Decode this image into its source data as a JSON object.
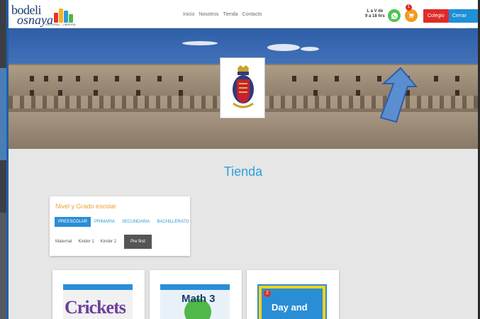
{
  "brand": {
    "name_line1": "bodeli",
    "name_line2": "osnaya",
    "tagline": "EDITORIAL · LIBRERÍA"
  },
  "nav": {
    "links": [
      "Inicio",
      "Nosotros",
      "Tienda",
      "Contacto"
    ]
  },
  "header": {
    "hours": "L a V de\n9 a 18 hrs",
    "cart_count": "1",
    "colegio_label": "Colegio",
    "logout_label": "Cerrar Sesion"
  },
  "page": {
    "title": "Tienda"
  },
  "level_filter": {
    "heading": "Nivel y Grado escolar",
    "levels": [
      "PREESCOLAR",
      "PRIMARIA",
      "SECUNDARIA",
      "BACHILLERATO"
    ],
    "active_level": "PREESCOLAR",
    "grades": [
      "Maternal",
      "Kinder 1",
      "Kinder 2",
      "Pre first"
    ],
    "active_grade": "Pre first"
  },
  "products": [
    {
      "cover_text": "Crickets"
    },
    {
      "cover_text": "Math 3"
    },
    {
      "cover_text": "Day and"
    }
  ],
  "colors": {
    "accent_blue": "#2aa0d8",
    "colegio_red": "#e02a2a",
    "logout_blue": "#1e90d8",
    "heading_orange": "#e9a23a",
    "whatsapp_green": "#4cc553",
    "cart_orange": "#f39a1d"
  },
  "icons": [
    "whatsapp-icon",
    "shopping-cart-icon",
    "crest-image",
    "annotation-arrow"
  ]
}
